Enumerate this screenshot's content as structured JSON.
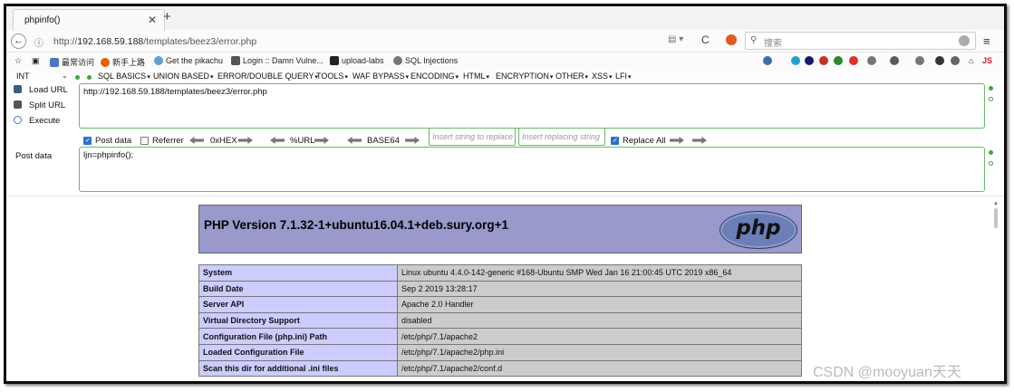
{
  "tab": {
    "title": "phpinfo()",
    "close": "✕",
    "new_tab": "+"
  },
  "nav": {
    "back": "←",
    "info": "ⓘ",
    "url_prefix": "http://",
    "url_host": "192.168.59.188",
    "url_path": "/templates/beez3/error.php",
    "reload": "C",
    "search_placeholder": "搜索",
    "menu": "≡"
  },
  "bookmarks": {
    "items": [
      {
        "label": "最常访问",
        "color": "#4a79c2"
      },
      {
        "label": "新手上路",
        "color": "#e66000"
      },
      {
        "label": "Get the pikachu",
        "color": "#5aa0d8"
      },
      {
        "label": "Login :: Damn Vulne...",
        "color": "#555555"
      },
      {
        "label": "upload-labs",
        "color": "#222222"
      },
      {
        "label": "SQL Injections",
        "color": "#777777"
      }
    ],
    "addon_colors": [
      "#3b6ea5",
      "#e0302a",
      "#2a8a2a",
      "#1a1a6a",
      "#c9302c",
      "#24a0c8",
      "#777777",
      "#5a5a5a",
      "#aa3333"
    ],
    "js_label": "JS"
  },
  "hackbar": {
    "int_select": "INT",
    "menus": [
      "SQL BASICS",
      "UNION BASED",
      "ERROR/DOUBLE QUERY",
      "TOOLS",
      "WAF BYPASS",
      "ENCODING",
      "HTML",
      "ENCRYPTION",
      "OTHER",
      "XSS",
      "LFI"
    ],
    "load_url": "Load URL",
    "split_url": "Split URL",
    "execute": "Execute",
    "url_value": "http://192.168.59.188/templates/beez3/error.php",
    "post_data_check": "Post data",
    "referrer_check": "Referrer",
    "hex": "0xHEX",
    "url_enc": "%URL",
    "base64": "BASE64",
    "replace_placeholder": "Insert string to replace",
    "replacing_placeholder": "Insert replacing string",
    "replace_all": "Replace All",
    "post_data_label": "Post data",
    "post_data_value": "ljn=phpinfo();"
  },
  "phpinfo": {
    "title": "PHP Version 7.1.32-1+ubuntu16.04.1+deb.sury.org+1",
    "logo_text": "php",
    "rows": [
      {
        "key": "System",
        "value": "Linux ubuntu 4.4.0-142-generic #168-Ubuntu SMP Wed Jan 16 21:00:45 UTC 2019 x86_64"
      },
      {
        "key": "Build Date",
        "value": "Sep 2 2019 13:28:17"
      },
      {
        "key": "Server API",
        "value": "Apache 2.0 Handler"
      },
      {
        "key": "Virtual Directory Support",
        "value": "disabled"
      },
      {
        "key": "Configuration File (php.ini) Path",
        "value": "/etc/php/7.1/apache2"
      },
      {
        "key": "Loaded Configuration File",
        "value": "/etc/php/7.1/apache2/php.ini"
      },
      {
        "key": "Scan this dir for additional .ini files",
        "value": "/etc/php/7.1/apache2/conf.d"
      }
    ]
  },
  "watermark": "CSDN @mooyuan天天"
}
